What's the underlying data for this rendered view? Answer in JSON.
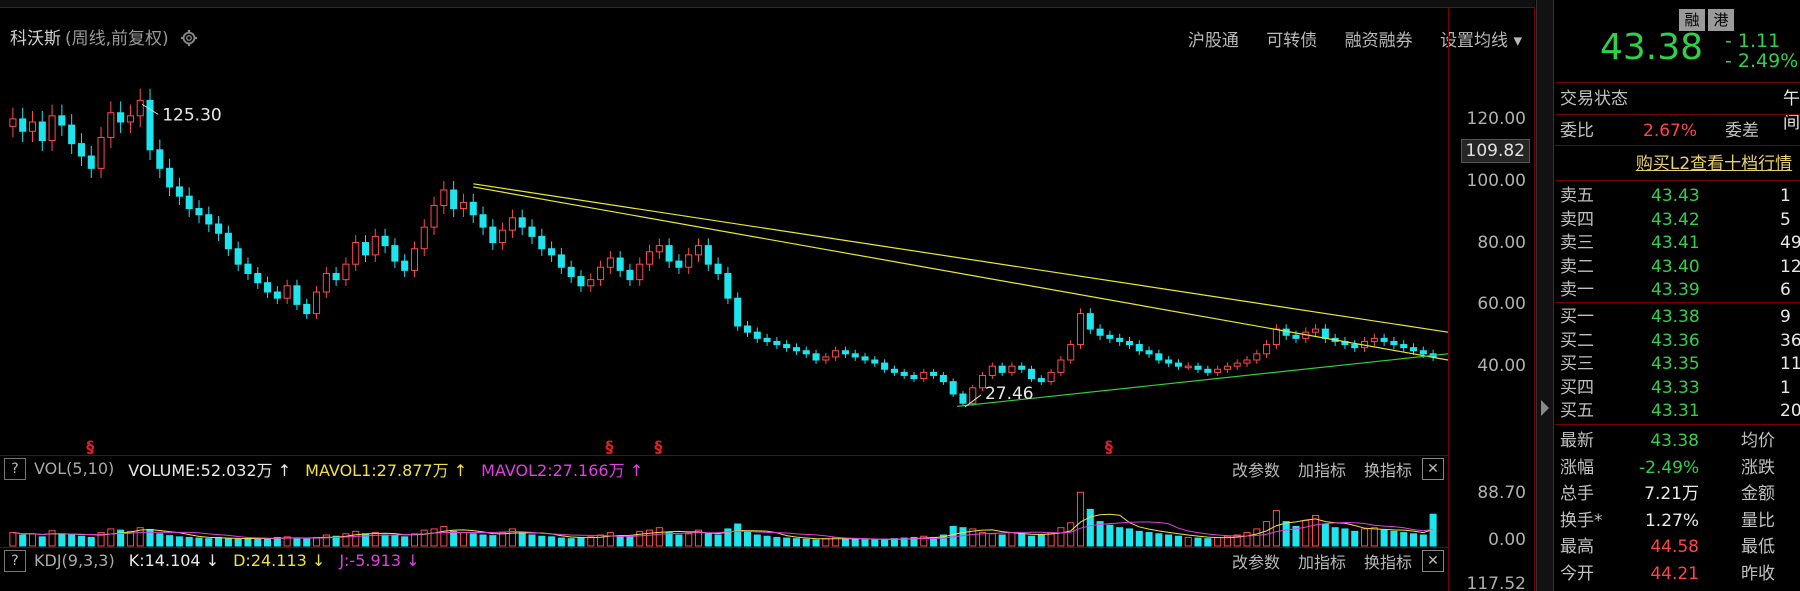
{
  "stock": {
    "name": "科沃斯",
    "period": "(周线,前复权)",
    "last_price": "43.38",
    "change": "- 1.11",
    "change_pct": "- 2.49%",
    "badges": [
      "融",
      "港"
    ]
  },
  "toolbar": [
    "沪股通",
    "可转债",
    "融资融券",
    "设置均线"
  ],
  "price_axis": {
    "ticks": [
      {
        "label": "120.00",
        "value": 120
      },
      {
        "label": "100.00",
        "value": 100
      },
      {
        "label": "80.00",
        "value": 80
      },
      {
        "label": "60.00",
        "value": 60
      },
      {
        "label": "40.00",
        "value": 40
      }
    ],
    "current_marker": "109.82"
  },
  "annotations": {
    "high": "125.30",
    "low": "27.46"
  },
  "volume_panel": {
    "name": "VOL(5,10)",
    "volume": "VOLUME:52.032万",
    "mavol1": "MAVOL1:27.877万",
    "mavol2": "MAVOL2:27.166万",
    "ticks": [
      "88.70",
      "0.00"
    ],
    "buttons": [
      "改参数",
      "加指标",
      "换指标"
    ]
  },
  "kdj_panel": {
    "name": "KDJ(9,3,3)",
    "k": "K:14.104",
    "d": "D:24.113",
    "j": "J:-5.913",
    "tick": "117.52",
    "buttons": [
      "改参数",
      "加指标",
      "换指标"
    ]
  },
  "quote": {
    "status_label": "交易状态",
    "status_value": "午间",
    "wb_label": "委比",
    "wb_value": "2.67%",
    "wc_label": "委差",
    "l2_link": "购买L2查看十档行情",
    "sells": [
      {
        "label": "卖五",
        "price": "43.43",
        "vol": "1"
      },
      {
        "label": "卖四",
        "price": "43.42",
        "vol": "5"
      },
      {
        "label": "卖三",
        "price": "43.41",
        "vol": "49"
      },
      {
        "label": "卖二",
        "price": "43.40",
        "vol": "12"
      },
      {
        "label": "卖一",
        "price": "43.39",
        "vol": "6"
      }
    ],
    "buys": [
      {
        "label": "买一",
        "price": "43.38",
        "vol": "9"
      },
      {
        "label": "买二",
        "price": "43.36",
        "vol": "36"
      },
      {
        "label": "买三",
        "price": "43.35",
        "vol": "11"
      },
      {
        "label": "买四",
        "price": "43.33",
        "vol": "1"
      },
      {
        "label": "买五",
        "price": "43.31",
        "vol": "20"
      }
    ],
    "stats": [
      {
        "l1": "最新",
        "v1": "43.38",
        "c1": "green",
        "l2": "均价"
      },
      {
        "l1": "涨幅",
        "v1": "-2.49%",
        "c1": "green",
        "l2": "涨跌"
      },
      {
        "l1": "总手",
        "v1": "7.21万",
        "c1": "white",
        "l2": "金额"
      },
      {
        "l1": "换手*",
        "v1": "1.27%",
        "c1": "white",
        "l2": "量比"
      },
      {
        "l1": "最高",
        "v1": "44.58",
        "c1": "red",
        "l2": "最低"
      },
      {
        "l1": "今开",
        "v1": "44.21",
        "c1": "red",
        "l2": "昨收"
      }
    ]
  },
  "chart_data": {
    "type": "candlestick",
    "ylim": [
      20,
      130
    ],
    "closes": [
      120,
      116,
      119,
      113,
      121,
      118,
      112,
      108,
      104,
      114,
      122,
      119,
      121,
      126,
      110,
      104,
      98,
      95,
      91,
      89,
      86,
      83,
      78,
      73,
      70,
      67,
      64,
      62,
      66,
      60,
      57,
      64,
      70,
      68,
      73,
      80,
      76,
      82,
      79,
      74,
      71,
      78,
      85,
      92,
      97,
      91,
      93,
      89,
      85,
      80,
      84,
      88,
      85,
      82,
      78,
      76,
      72,
      69,
      66,
      68,
      72,
      75,
      71,
      68,
      73,
      77,
      79,
      74,
      72,
      76,
      79,
      73,
      70,
      62,
      53,
      51,
      49,
      48,
      47,
      46,
      45,
      44,
      42,
      43,
      45,
      44,
      43,
      42,
      41,
      39,
      38,
      37,
      36,
      38,
      37,
      35,
      31,
      28,
      33,
      37,
      40,
      38,
      40,
      39,
      36,
      35,
      38,
      42,
      47,
      57,
      52,
      50,
      49,
      48,
      47,
      45,
      44,
      42,
      41,
      40,
      40,
      39,
      38,
      39,
      40,
      41,
      42,
      44,
      47,
      52,
      50,
      49,
      51,
      52,
      49,
      48,
      47,
      46,
      48,
      49,
      48,
      47,
      46,
      45,
      44,
      43
    ],
    "volumes": [
      22,
      18,
      20,
      15,
      25,
      20,
      18,
      16,
      14,
      22,
      28,
      26,
      24,
      30,
      27,
      20,
      17,
      15,
      14,
      13,
      12,
      14,
      12,
      11,
      12,
      13,
      12,
      14,
      15,
      13,
      12,
      14,
      18,
      16,
      20,
      24,
      20,
      22,
      18,
      17,
      15,
      20,
      26,
      28,
      32,
      24,
      22,
      20,
      18,
      17,
      22,
      28,
      22,
      18,
      16,
      15,
      13,
      12,
      14,
      15,
      18,
      22,
      17,
      15,
      24,
      26,
      30,
      22,
      18,
      20,
      26,
      20,
      18,
      28,
      36,
      24,
      18,
      16,
      14,
      13,
      12,
      11,
      10,
      12,
      14,
      12,
      11,
      10,
      10,
      11,
      12,
      13,
      14,
      16,
      14,
      18,
      32,
      30,
      28,
      22,
      20,
      18,
      22,
      20,
      16,
      18,
      22,
      30,
      38,
      88,
      60,
      40,
      34,
      30,
      28,
      24,
      22,
      20,
      18,
      16,
      14,
      13,
      12,
      14,
      16,
      18,
      22,
      28,
      40,
      58,
      40,
      32,
      42,
      50,
      36,
      30,
      28,
      24,
      28,
      30,
      26,
      24,
      22,
      20,
      18,
      52
    ]
  }
}
